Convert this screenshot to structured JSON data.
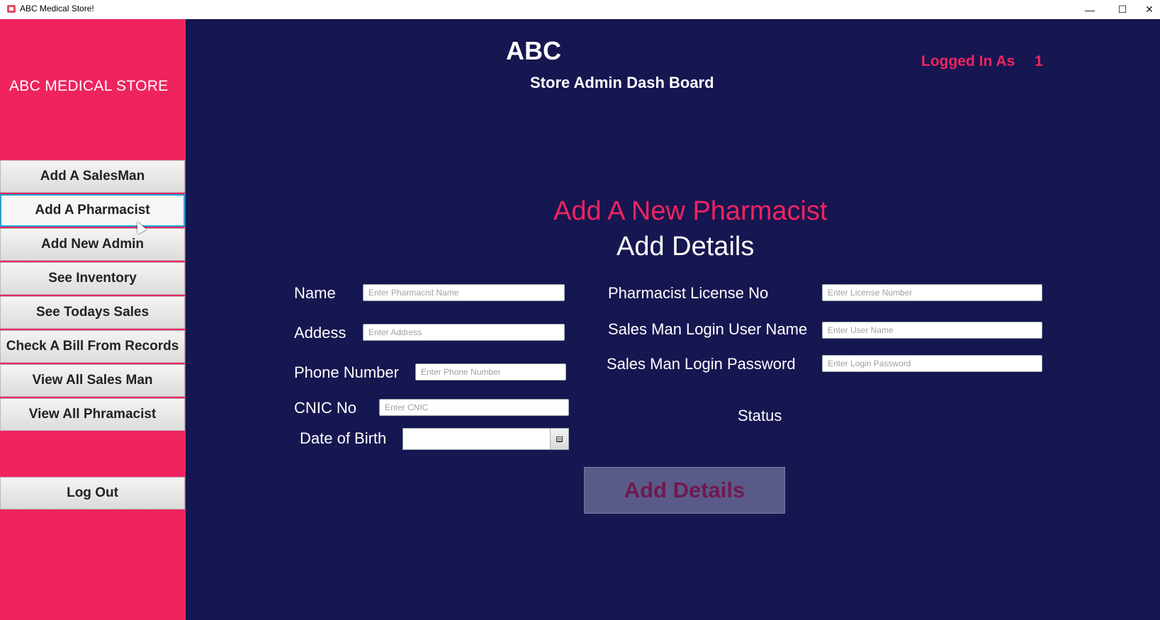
{
  "window": {
    "title": "ABC Medical Store!",
    "controls": {
      "minimize": "—",
      "maximize": "☐",
      "close": "✕"
    }
  },
  "sidebar": {
    "brand": "ABC MEDICAL STORE",
    "items": [
      {
        "label": "Add A SalesMan"
      },
      {
        "label": "Add A Pharmacist"
      },
      {
        "label": "Add New Admin"
      },
      {
        "label": "See Inventory"
      },
      {
        "label": "See Todays Sales"
      },
      {
        "label": "Check A Bill From Records"
      },
      {
        "label": "View All Sales Man"
      },
      {
        "label": "View All  Phramacist"
      }
    ],
    "logout_label": "Log Out"
  },
  "header": {
    "store_name": "ABC",
    "dashboard_title": "Store Admin Dash Board",
    "logged_in_label": "Logged In As",
    "logged_in_value": "1"
  },
  "form": {
    "heading": "Add A New Pharmacist",
    "subheading": "Add Details",
    "fields": {
      "name": {
        "label": "Name",
        "placeholder": "Enter Pharmacist Name",
        "value": ""
      },
      "address": {
        "label": "Addess",
        "placeholder": "Enter Address",
        "value": ""
      },
      "phone": {
        "label": "Phone Number",
        "placeholder": "Enter Phone Number",
        "value": ""
      },
      "cnic": {
        "label": "CNIC No",
        "placeholder": "Enter CNIC",
        "value": ""
      },
      "dob": {
        "label": "Date of Birth",
        "value": ""
      },
      "license": {
        "label": "Pharmacist License No",
        "placeholder": "Enter License Number",
        "value": ""
      },
      "username": {
        "label": "Sales Man Login User Name",
        "placeholder": "Enter User Name",
        "value": ""
      },
      "password": {
        "label": "Sales Man Login Password",
        "placeholder": "Enter Login Password",
        "value": ""
      }
    },
    "status_label": "Status",
    "submit_label": "Add Details"
  },
  "colors": {
    "sidebar_bg": "#ef245f",
    "main_bg": "#161651",
    "accent": "#ef245f",
    "submit_bg": "#5a5a88",
    "submit_text": "#6f1a4f"
  },
  "icons": {
    "app": "medical-store-icon",
    "calendar": "calendar-icon"
  }
}
